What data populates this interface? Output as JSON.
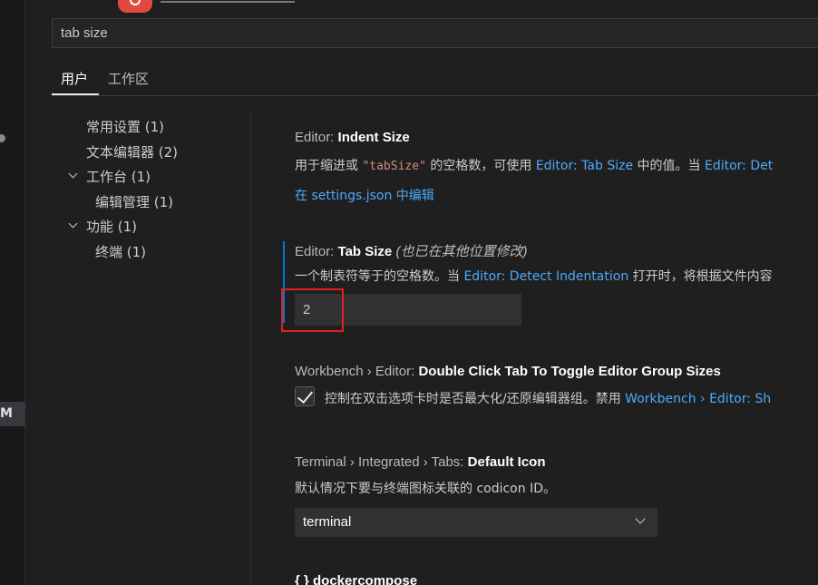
{
  "left_strip": {
    "badge": "M"
  },
  "search": {
    "value": "tab size"
  },
  "tabs": {
    "user": "用户",
    "workspace": "工作区"
  },
  "toc": {
    "common": "常用设置 (1)",
    "text_editor": "文本编辑器 (2)",
    "workbench": "工作台 (1)",
    "editor_management": "编辑管理 (1)",
    "features": "功能 (1)",
    "terminal": "终端 (1)"
  },
  "settings": {
    "indent_size": {
      "category": "Editor: ",
      "name": "Indent Size",
      "desc_prefix": "用于缩进或 ",
      "desc_code": "\"tabSize\"",
      "desc_mid": " 的空格数，可使用 ",
      "desc_link": "Editor: Tab Size",
      "desc_after": " 中的值。当 ",
      "desc_link2": "Editor: Det",
      "edit_link": "在 settings.json 中编辑"
    },
    "tab_size": {
      "category": "Editor: ",
      "name": "Tab Size",
      "modified_note": "(也已在其他位置修改)",
      "desc_prefix": "一个制表符等于的空格数。当 ",
      "desc_link": "Editor: Detect Indentation",
      "desc_after": " 打开时，将根据文件内容",
      "value": "2"
    },
    "double_click_tab": {
      "category": "Workbench › Editor: ",
      "name": "Double Click Tab To Toggle Editor Group Sizes",
      "desc_prefix": "控制在双击选项卡时是否最大化/还原编辑器组。禁用 ",
      "desc_link": "Workbench › Editor: Sh",
      "checked": true
    },
    "default_icon": {
      "category": "Terminal › Integrated › Tabs: ",
      "name": "Default Icon",
      "desc": "默认情况下要与终端图标关联的 codicon ID。",
      "value": "terminal"
    },
    "next_section": "{ } dockercompose"
  },
  "colors": {
    "accent": "#0078d4",
    "link": "#4daafc",
    "highlight_box": "#e02020"
  }
}
